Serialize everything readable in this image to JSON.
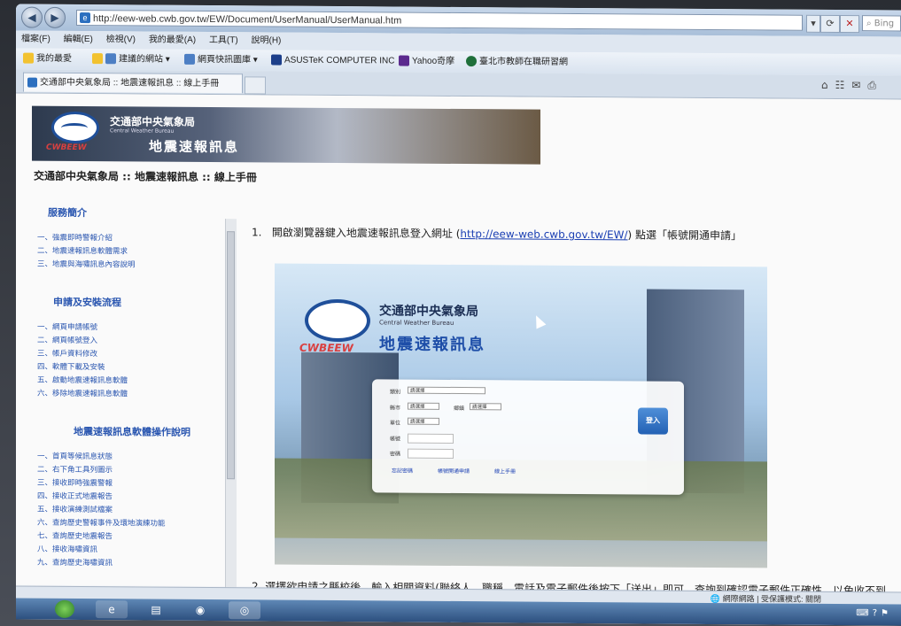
{
  "browser": {
    "url": "http://eew-web.cwb.gov.tw/EW/Document/UserManual/UserManual.htm",
    "search_placeholder": "Bing",
    "menu": [
      "檔案(F)",
      "編輯(E)",
      "檢視(V)",
      "我的最愛(A)",
      "工具(T)",
      "說明(H)"
    ],
    "favorites": [
      "我的最愛",
      "建議的網站 ▾",
      "網頁快訊圖庫 ▾",
      "ASUSTeK COMPUTER INC",
      "Yahoo奇摩",
      "臺北市教師在職研習網"
    ],
    "tab_title": "交通部中央氣象局 :: 地震速報訊息 :: 線上手冊"
  },
  "banner": {
    "org_name": "交通部中央氣象局",
    "org_en": "Central Weather Bureau",
    "product": "地震速報訊息",
    "logo_text": "CWBEEW"
  },
  "breadcrumb": "交通部中央氣象局 :: 地震速報訊息 :: 線上手冊",
  "sidebar": {
    "section1": {
      "title": "服務簡介",
      "items": [
        "一、強震即時警報介紹",
        "二、地震速報訊息軟體需求",
        "三、地震與海嘯訊息內容說明"
      ]
    },
    "section2": {
      "title": "申請及安裝流程",
      "items": [
        "一、網頁申請帳號",
        "二、網頁帳號登入",
        "三、帳戶資料修改",
        "四、軟體下載及安裝",
        "五、啟動地震速報訊息軟體",
        "六、移除地震速報訊息軟體"
      ]
    },
    "section3": {
      "title": "地震速報訊息軟體操作說明",
      "items": [
        "一、首頁等候訊息狀態",
        "二、右下角工具列圖示",
        "三、接收即時強震警報",
        "四、接收正式地震報告",
        "五、接收演練測試檔案",
        "六、查詢歷史警報事件及環地演練功能",
        "七、查詢歷史地震報告",
        "八、接收海嘯資訊",
        "九、查詢歷史海嘯資訊"
      ]
    }
  },
  "content": {
    "step1_num": "1.",
    "step1_pre": "開啟瀏覽器鍵入地震速報訊息登入網址 (",
    "step1_link": "http://eew-web.cwb.gov.tw/EW/",
    "step1_post": ") 點選「帳號開通申請」",
    "step2": "2.   選擇欲申請之縣校後，輸入相關資料(聯絡人、職稱、電話及電子郵件後按下「送出」即可，查詢到確認電子郵件正確性，以免收不到",
    "login": {
      "category_label": "類別",
      "category_value": "請選擇",
      "city_label": "縣市",
      "city_value": "請選擇",
      "town_label": "鄉鎮",
      "town_value": "請選擇",
      "unit_label": "單位",
      "unit_value": "請選擇",
      "account_label": "帳號",
      "password_label": "密碼",
      "login_button": "登入",
      "forgot": "忘記密碼",
      "apply": "帳號開通申請",
      "manual": "線上手冊"
    }
  },
  "status": {
    "zone": "網際網路 | 受保護模式: 關閉"
  }
}
